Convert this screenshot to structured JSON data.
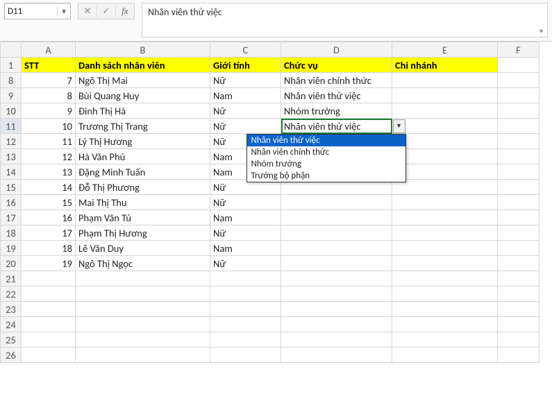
{
  "formula_bar": {
    "cell_ref": "D11",
    "cancel": "✕",
    "confirm": "✓",
    "fx": "fx",
    "value": "Nhân viên thử việc"
  },
  "columns": [
    "A",
    "B",
    "C",
    "D",
    "E",
    "F"
  ],
  "row_numbers": [
    1,
    8,
    9,
    10,
    11,
    12,
    13,
    14,
    15,
    16,
    17,
    18,
    19,
    20,
    21,
    22,
    23,
    24,
    25,
    26
  ],
  "header": {
    "A": "STT",
    "B": "Danh sách nhân viên",
    "C": "Giới tính",
    "D": "Chức vụ",
    "E": "Chi nhánh"
  },
  "rows": [
    {
      "stt": 7,
      "name": "Ngô Thị Mai",
      "sex": "Nữ",
      "role": "Nhân viên chính thức"
    },
    {
      "stt": 8,
      "name": "Bùi Quang Huy",
      "sex": "Nam",
      "role": "Nhân viên thử việc"
    },
    {
      "stt": 9,
      "name": "Đinh Thị Hà",
      "sex": "Nữ",
      "role": "Nhóm trưởng"
    },
    {
      "stt": 10,
      "name": "Trương Thị Trang",
      "sex": "Nữ",
      "role": "Nhân viên thử việc"
    },
    {
      "stt": 11,
      "name": "Lý Thị Hương",
      "sex": "Nữ",
      "role": ""
    },
    {
      "stt": 12,
      "name": "Hà Văn Phú",
      "sex": "Nam",
      "role": ""
    },
    {
      "stt": 13,
      "name": "Đặng Minh Tuấn",
      "sex": "Nam",
      "role": ""
    },
    {
      "stt": 14,
      "name": "Đỗ Thị Phương",
      "sex": "Nữ",
      "role": ""
    },
    {
      "stt": 15,
      "name": "Mai Thị Thu",
      "sex": "Nữ",
      "role": ""
    },
    {
      "stt": 16,
      "name": "Phạm Văn Tú",
      "sex": "Nam",
      "role": ""
    },
    {
      "stt": 17,
      "name": "Phạm Thị Hương",
      "sex": "Nữ",
      "role": ""
    },
    {
      "stt": 18,
      "name": "Lê Văn Duy",
      "sex": "Nam",
      "role": ""
    },
    {
      "stt": 19,
      "name": "Ngô Thị Ngọc",
      "sex": "Nữ",
      "role": ""
    }
  ],
  "active_cell": {
    "row": 11,
    "col": "D"
  },
  "dropdown": {
    "options": [
      "Nhân viên thử việc",
      "Nhân viên chính thức",
      "Nhóm trưởng",
      "Trưởng bộ phận"
    ],
    "selected_index": 0
  }
}
